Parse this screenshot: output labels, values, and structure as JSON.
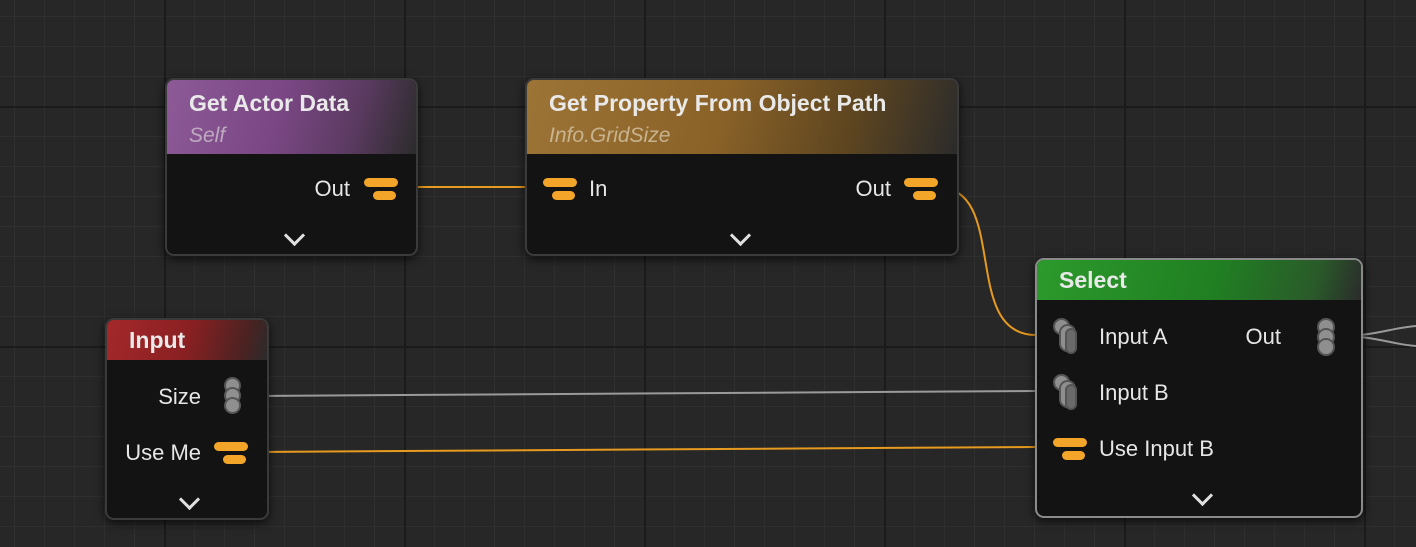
{
  "nodes": {
    "get_actor_data": {
      "title": "Get Actor Data",
      "subtitle": "Self",
      "out_label": "Out"
    },
    "get_property": {
      "title": "Get Property From Object Path",
      "subtitle": "Info.GridSize",
      "in_label": "In",
      "out_label": "Out"
    },
    "input": {
      "title": "Input",
      "pins": {
        "size": "Size",
        "use_me": "Use Me"
      }
    },
    "select": {
      "title": "Select",
      "pins": {
        "input_a": "Input A",
        "input_b": "Input B",
        "use_input_b": "Use Input B",
        "out": "Out"
      }
    }
  },
  "pin_icons": {
    "boolean": "boolean-pin-icon",
    "multi": "multi-value-pin-icon",
    "expand": "chevron-down-icon"
  },
  "colors": {
    "canvas": "#272727",
    "wire_bool": "#e69a1f",
    "wire_generic": "#9a9a9a",
    "pin_bool": "#f3a52a",
    "header_actor": "#8d5a98",
    "header_property": "#9c7436",
    "header_input": "#a3282b",
    "header_select": "#2c9a2c"
  }
}
